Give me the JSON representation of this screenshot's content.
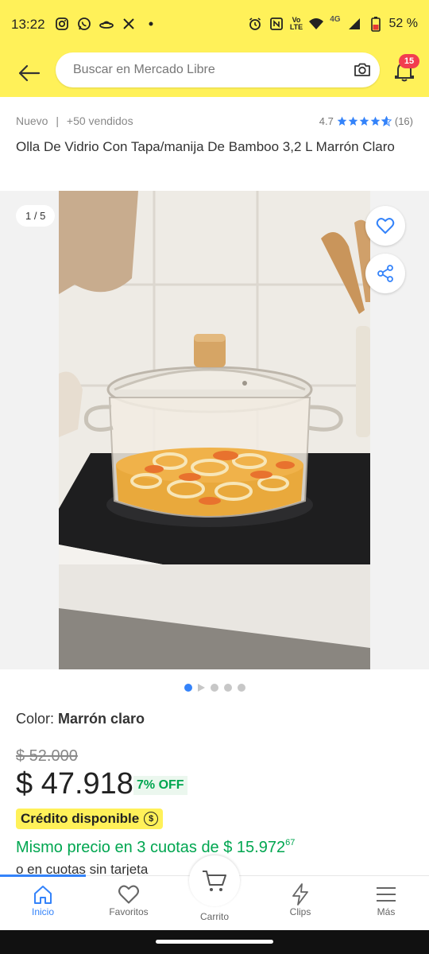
{
  "status": {
    "time": "13:22",
    "network": "4G",
    "volte_top": "Vo",
    "volte_bottom": "LTE",
    "battery": "52 %"
  },
  "search": {
    "placeholder": "Buscar en Mercado Libre",
    "notifications": "15"
  },
  "product": {
    "condition": "Nuevo",
    "separator": "|",
    "sold": "+50 vendidos",
    "rating_value": "4.7",
    "rating_stars": 4.7,
    "reviews": "(16)",
    "title": "Olla De Vidrio Con Tapa/manija De Bamboo  3,2 L Marrón Claro",
    "image_counter": "1 / 5",
    "color_label": "Color: ",
    "color_value": "Marrón claro",
    "old_price": "$ 52.000",
    "price": "$ 47.918",
    "discount": "7% OFF",
    "credit": "Crédito disponible",
    "installments_prefix": "Mismo precio en 3 cuotas de $ 15.972",
    "installments_cents": "67",
    "cuotas_text": "o en cuotas sin tarjeta"
  },
  "nav": {
    "home": "Inicio",
    "favorites": "Favoritos",
    "cart": "Carrito",
    "clips": "Clips",
    "more": "Más"
  },
  "colors": {
    "brand_yellow": "#fff159",
    "accent_blue": "#3483fa",
    "green": "#00a650",
    "badge_red": "#f23d4f"
  },
  "icons": [
    "back-arrow-icon",
    "camera-icon",
    "bell-icon",
    "heart-icon",
    "share-icon",
    "star-icon",
    "home-icon",
    "cart-icon",
    "bolt-icon",
    "menu-icon"
  ]
}
